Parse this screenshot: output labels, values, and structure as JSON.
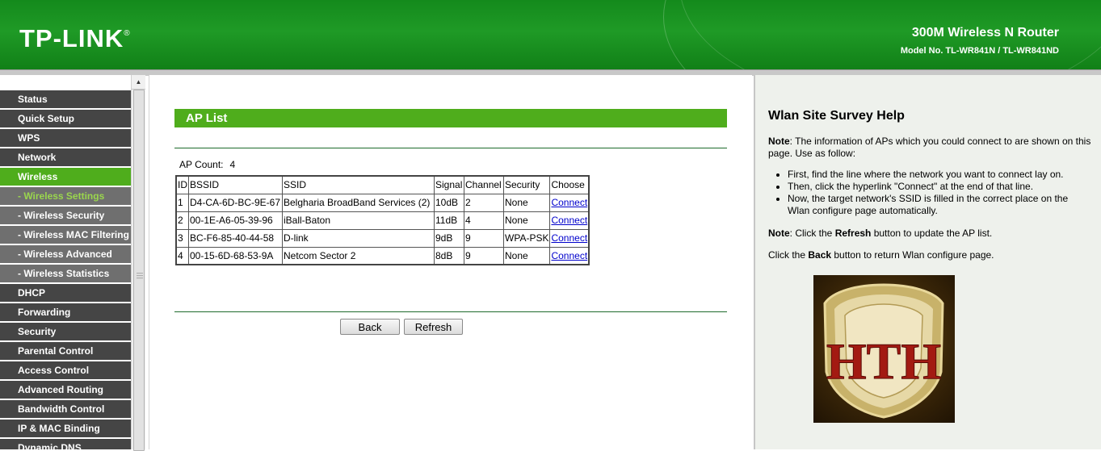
{
  "header": {
    "logo": "TP-LINK",
    "logo_mark": "®",
    "product": "300M Wireless N Router",
    "model": "Model No. TL-WR841N / TL-WR841ND"
  },
  "sidebar": {
    "items": [
      {
        "label": "Status",
        "sub": false,
        "active": false
      },
      {
        "label": "Quick Setup",
        "sub": false,
        "active": false
      },
      {
        "label": "WPS",
        "sub": false,
        "active": false
      },
      {
        "label": "Network",
        "sub": false,
        "active": false
      },
      {
        "label": "Wireless",
        "sub": false,
        "active": true
      },
      {
        "label": "- Wireless Settings",
        "sub": true,
        "active": true
      },
      {
        "label": "- Wireless Security",
        "sub": true,
        "active": false
      },
      {
        "label": "- Wireless MAC Filtering",
        "sub": true,
        "active": false
      },
      {
        "label": "- Wireless Advanced",
        "sub": true,
        "active": false
      },
      {
        "label": "- Wireless Statistics",
        "sub": true,
        "active": false
      },
      {
        "label": "DHCP",
        "sub": false,
        "active": false
      },
      {
        "label": "Forwarding",
        "sub": false,
        "active": false
      },
      {
        "label": "Security",
        "sub": false,
        "active": false
      },
      {
        "label": "Parental Control",
        "sub": false,
        "active": false
      },
      {
        "label": "Access Control",
        "sub": false,
        "active": false
      },
      {
        "label": "Advanced Routing",
        "sub": false,
        "active": false
      },
      {
        "label": "Bandwidth Control",
        "sub": false,
        "active": false
      },
      {
        "label": "IP & MAC Binding",
        "sub": false,
        "active": false
      },
      {
        "label": "Dynamic DNS",
        "sub": false,
        "active": false
      }
    ]
  },
  "main": {
    "title": "AP List",
    "ap_count_label": "AP Count:",
    "ap_count": "4",
    "columns": [
      "ID",
      "BSSID",
      "SSID",
      "Signal",
      "Channel",
      "Security",
      "Choose"
    ],
    "rows": [
      [
        "1",
        "D4-CA-6D-BC-9E-67",
        "Belgharia BroadBand Services (2)",
        "10dB",
        "2",
        "None",
        "Connect"
      ],
      [
        "2",
        "00-1E-A6-05-39-96",
        "iBall-Baton",
        "11dB",
        "4",
        "None",
        "Connect"
      ],
      [
        "3",
        "BC-F6-85-40-44-58",
        "D-link",
        "9dB",
        "9",
        "WPA-PSK",
        "Connect"
      ],
      [
        "4",
        "00-15-6D-68-53-9A",
        "Netcom Sector 2",
        "8dB",
        "9",
        "None",
        "Connect"
      ]
    ],
    "back_label": "Back",
    "refresh_label": "Refresh"
  },
  "help": {
    "title": "Wlan Site Survey Help",
    "note1_bold": "Note",
    "note1_text": ": The information of APs which you could connect to are shown on this page. Use as follow:",
    "steps": [
      "First, find the line where the network you want to connect lay on.",
      "Then, click the hyperlink \"Connect\" at the end of that line.",
      "Now, the target network's SSID is filled in the correct place on the Wlan configure page automatically."
    ],
    "note2_bold": "Note",
    "note2_a": ": Click the ",
    "note2_refresh": "Refresh",
    "note2_b": " button to update the AP list.",
    "back_a": "Click the ",
    "back_bold": "Back",
    "back_b": " button to return Wlan configure page.",
    "image_letters": "HTH"
  }
}
